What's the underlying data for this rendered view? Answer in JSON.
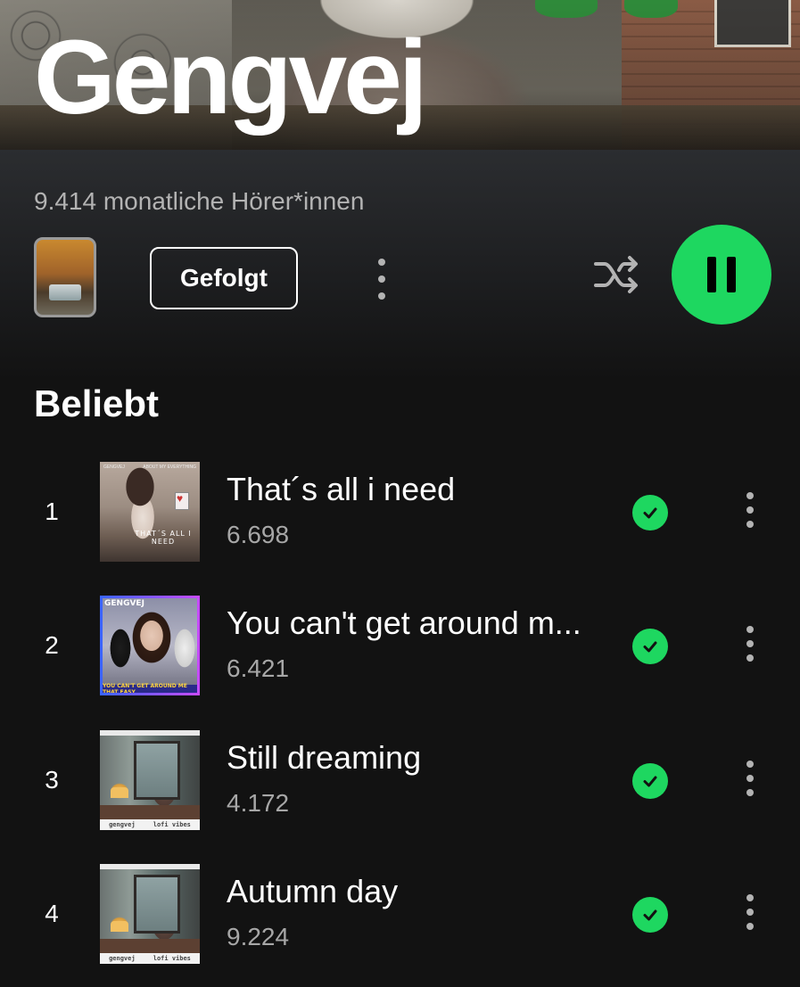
{
  "artist": {
    "name": "Gengvej",
    "monthly_listeners": "9.414 monatliche Hörer*innen"
  },
  "actions": {
    "follow_label": "Gefolgt",
    "more_icon": "more-vertical-icon",
    "shuffle_icon": "shuffle-icon",
    "play_state": "pause-icon"
  },
  "colors": {
    "accent": "#1ed760",
    "background": "#121212",
    "secondary_text": "#b3b3b3"
  },
  "popular": {
    "title": "Beliebt",
    "tracks": [
      {
        "number": "1",
        "title": "That´s all i need",
        "plays": "6.698",
        "art_text": "THAT´S ALL I NEED",
        "art_top_left": "GENGVEJ",
        "art_top_right": "ABOUT MY EVERYTHING",
        "saved": true
      },
      {
        "number": "2",
        "title": "You can't get around m...",
        "plays": "6.421",
        "art_text": "GENGVEJ",
        "art_bottom": "YOU CAN'T GET AROUND ME THAT EASY",
        "saved": true
      },
      {
        "number": "3",
        "title": "Still dreaming",
        "plays": "4.172",
        "art_left": "gengvej",
        "art_right": "lofi vibes",
        "saved": true
      },
      {
        "number": "4",
        "title": "Autumn day",
        "plays": "9.224",
        "art_left": "gengvej",
        "art_right": "lofi vibes",
        "saved": true
      }
    ]
  }
}
